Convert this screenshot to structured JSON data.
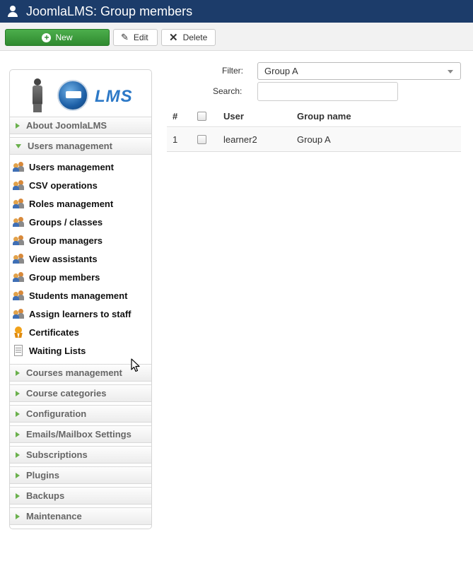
{
  "header": {
    "title": "JoomlaLMS: Group members",
    "icon": "user-icon",
    "background": "#1c3c6a"
  },
  "toolbar": {
    "new_label": "New",
    "edit_label": "Edit",
    "delete_label": "Delete",
    "new_color": "#3c9f3c"
  },
  "sidebar": {
    "logo_text": "LMS",
    "about": "About JoomlaLMS",
    "users_management": "Users management",
    "sub_items": [
      {
        "label": "Users management",
        "icon": "users-icon"
      },
      {
        "label": "CSV operations",
        "icon": "users-icon"
      },
      {
        "label": "Roles management",
        "icon": "users-icon"
      },
      {
        "label": "Groups / classes",
        "icon": "users-icon"
      },
      {
        "label": "Group managers",
        "icon": "users-icon"
      },
      {
        "label": "View assistants",
        "icon": "users-icon"
      },
      {
        "label": "Group members",
        "icon": "users-icon"
      },
      {
        "label": "Students management",
        "icon": "users-icon"
      },
      {
        "label": "Assign learners to staff",
        "icon": "users-icon"
      },
      {
        "label": "Certificates",
        "icon": "certificate-icon"
      },
      {
        "label": "Waiting Lists",
        "icon": "document-icon"
      }
    ],
    "groups": [
      "Courses management",
      "Course categories",
      "Configuration",
      "Emails/Mailbox Settings",
      "Subscriptions",
      "Plugins",
      "Backups",
      "Maintenance"
    ]
  },
  "filters": {
    "filter_label": "Filter:",
    "filter_value": "Group A",
    "search_label": "Search:",
    "search_value": ""
  },
  "table": {
    "headers": {
      "num": "#",
      "user": "User",
      "group": "Group name"
    },
    "rows": [
      {
        "num": "1",
        "user": "learner2",
        "group": "Group A"
      }
    ]
  }
}
